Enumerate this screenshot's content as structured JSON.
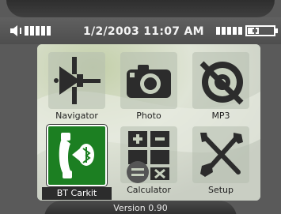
{
  "status_bar": {
    "datetime": "1/2/2003 11:07 AM",
    "volume_icon": "speaker-icon",
    "signal_icon": "signal-bars-icon",
    "battery_icon": "battery-icon"
  },
  "apps": [
    {
      "label": "Navigator",
      "icon": "satellite-icon",
      "selected": false
    },
    {
      "label": "Photo",
      "icon": "camera-icon",
      "selected": false
    },
    {
      "label": "MP3",
      "icon": "disc-muted-icon",
      "selected": false
    },
    {
      "label": "BT Carkit",
      "icon": "bluetooth-phone-icon",
      "selected": true
    },
    {
      "label": "Calculator",
      "icon": "calculator-icon",
      "selected": false
    },
    {
      "label": "Setup",
      "icon": "tools-icon",
      "selected": false
    }
  ],
  "footer": {
    "version": "Version 0.90"
  },
  "colors": {
    "selected_tile": "#1c7f22",
    "screen_bg": "#d9dcd6"
  }
}
